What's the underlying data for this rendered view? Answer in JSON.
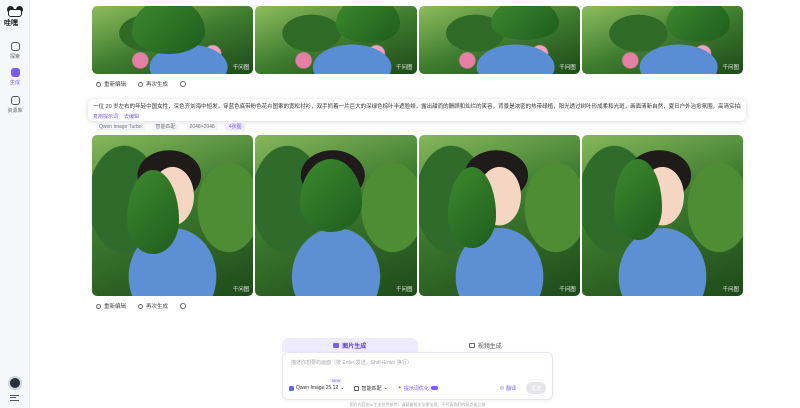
{
  "app": {
    "logo_text": "哇嘿"
  },
  "sidebar": {
    "items": [
      {
        "label": "探索",
        "icon": "compass-icon",
        "active": false
      },
      {
        "label": "生成",
        "icon": "sparkle-icon",
        "active": true
      },
      {
        "label": "资源库",
        "icon": "library-icon",
        "active": false
      }
    ]
  },
  "gallery": {
    "watermark": "千问图",
    "top_row_count": 4,
    "bottom_row_count": 4
  },
  "actions": {
    "reedit": "重新编辑",
    "regenerate": "再次生成"
  },
  "prompt": {
    "text": "一位 20 岁左右的年轻中国女性，深色齐刘海中短发，穿蓝色底带粉色花卉图案的宽松衬衫，双手抓着一片巨大的深绿色棕叶半遮脸颊，露出甜而的酬顾和灿烂的笑容，背景是浓密的热带绿植，阳光透过树叶形成柔和光斑，画面清新自然，夏日户外治愈氛围，高清实拍质感，色彩鲜亮柔和",
    "link_copy": "复用提示词",
    "link_edit": "去编辑"
  },
  "meta": {
    "model": "Qwen Image Turbo",
    "ratio": "智能匹配",
    "size": "2048×2048",
    "count": "4张图"
  },
  "composer": {
    "tabs": [
      {
        "label": "图片生成",
        "active": true
      },
      {
        "label": "视频生成",
        "active": false
      }
    ],
    "placeholder": "描述你想要的画面（按 Enter 发送，Shift+Enter 换行）",
    "model": "Qwen Image 25.12",
    "new_badge": "NEW",
    "ratio": "智能匹配",
    "enhance": "提示词优化",
    "translate": "翻译",
    "send": "发送",
    "disclaimer": "图片内容由AI生成仅供参考，请遵循相关法律法规，不代表我们的观点或立场"
  },
  "colors": {
    "accent": "#7b5cf6",
    "sidebar_bg": "#f6f7fb"
  }
}
